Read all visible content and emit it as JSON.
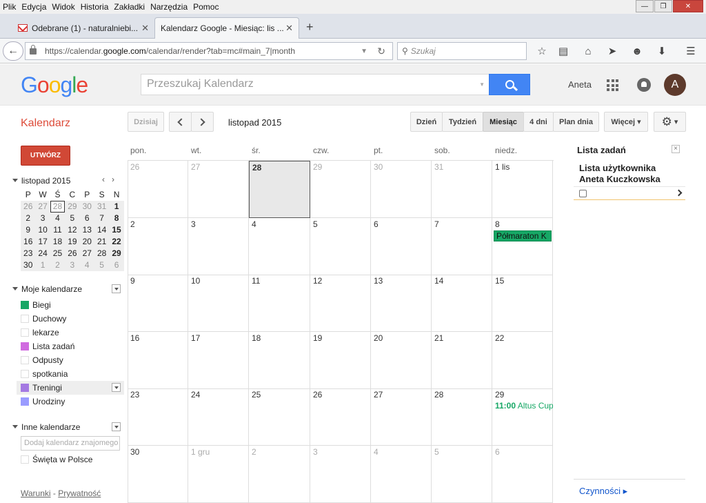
{
  "browser": {
    "menu": [
      "Plik",
      "Edycja",
      "Widok",
      "Historia",
      "Zakładki",
      "Narzędzia",
      "Pomoc"
    ],
    "tabs": [
      {
        "title": "Odebrane (1) - naturalniebi...",
        "icon": "gmail-icon"
      },
      {
        "title": "Kalendarz Google - Miesiąc: lis ...",
        "icon": "calendar-icon",
        "active": true
      }
    ],
    "new_tab": "+",
    "url_prefix": "https://calendar.",
    "url_host": "google.com",
    "url_path": "/calendar/render?tab=mc#main_7|month",
    "search_placeholder": "Szukaj"
  },
  "header": {
    "logo": "Google",
    "search_placeholder": "Przeszukaj Kalendarz",
    "user_name": "Aneta",
    "avatar_letter": "A",
    "colors": {
      "search_button": "#4285f4",
      "avatar": "#5d3a2c"
    }
  },
  "toolbar": {
    "app_title": "Kalendarz",
    "today": "Dzisiaj",
    "month_label": "listopad 2015",
    "views": [
      "Dzień",
      "Tydzień",
      "Miesiąc",
      "4 dni",
      "Plan dnia"
    ],
    "active_view": "Miesiąc",
    "more": "Więcej",
    "more_caret": "▾",
    "settings_caret": "▾"
  },
  "sidebar": {
    "create": "UTWÓRZ",
    "mini_month": "listopad 2015",
    "mini_prev": "‹",
    "mini_next": "›",
    "weekdays": [
      "P",
      "W",
      "Ś",
      "C",
      "P",
      "S",
      "N"
    ],
    "weeks": [
      [
        "26",
        "27",
        "28",
        "29",
        "30",
        "31",
        "1"
      ],
      [
        "2",
        "3",
        "4",
        "5",
        "6",
        "7",
        "8"
      ],
      [
        "9",
        "10",
        "11",
        "12",
        "13",
        "14",
        "15"
      ],
      [
        "16",
        "17",
        "18",
        "19",
        "20",
        "21",
        "22"
      ],
      [
        "23",
        "24",
        "25",
        "26",
        "27",
        "28",
        "29"
      ],
      [
        "30",
        "1",
        "2",
        "3",
        "4",
        "5",
        "6"
      ]
    ],
    "my_calendars_title": "Moje kalendarze",
    "my_calendars": [
      {
        "name": "Biegi",
        "color": "#16a765"
      },
      {
        "name": "Duchowy",
        "color": "#ffffff"
      },
      {
        "name": "lekarze",
        "color": "#ffffff"
      },
      {
        "name": "Lista zadań",
        "color": "#d06be0"
      },
      {
        "name": "Odpusty",
        "color": "#ffffff"
      },
      {
        "name": "spotkania",
        "color": "#ffffff"
      },
      {
        "name": "Treningi",
        "color": "#a479e2"
      },
      {
        "name": "Urodziny",
        "color": "#9a9cff"
      }
    ],
    "other_calendars_title": "Inne kalendarze",
    "add_friend_placeholder": "Dodaj kalendarz znajomego",
    "other_calendars": [
      {
        "name": "Święta w Polsce",
        "color": "#ffffff"
      }
    ],
    "footer_links": [
      "Warunki",
      "Prywatność"
    ],
    "footer_sep": "-"
  },
  "month": {
    "day_headers": [
      "pon.",
      "wt.",
      "śr.",
      "czw.",
      "pt.",
      "sob.",
      "niedz."
    ],
    "weeks": [
      [
        "26",
        "27",
        "28",
        "29",
        "30",
        "31",
        "1 lis"
      ],
      [
        "2",
        "3",
        "4",
        "5",
        "6",
        "7",
        "8"
      ],
      [
        "9",
        "10",
        "11",
        "12",
        "13",
        "14",
        "15"
      ],
      [
        "16",
        "17",
        "18",
        "19",
        "20",
        "21",
        "22"
      ],
      [
        "23",
        "24",
        "25",
        "26",
        "27",
        "28",
        "29"
      ],
      [
        "30",
        "1 gru",
        "2",
        "3",
        "4",
        "5",
        "6"
      ]
    ],
    "events": [
      {
        "week": 1,
        "day": 6,
        "title": "Półmaraton K",
        "color": "#16a765",
        "allday": true
      },
      {
        "week": 4,
        "day": 6,
        "time": "11:00",
        "title": "Altus Cup",
        "color": "#16a765",
        "allday": false
      }
    ]
  },
  "tasks": {
    "title": "Lista zadań",
    "close": "×",
    "list_name_line1": "Lista użytkownika",
    "list_name_line2": "Aneta Kuczkowska",
    "actions": "Czynności ▸"
  }
}
